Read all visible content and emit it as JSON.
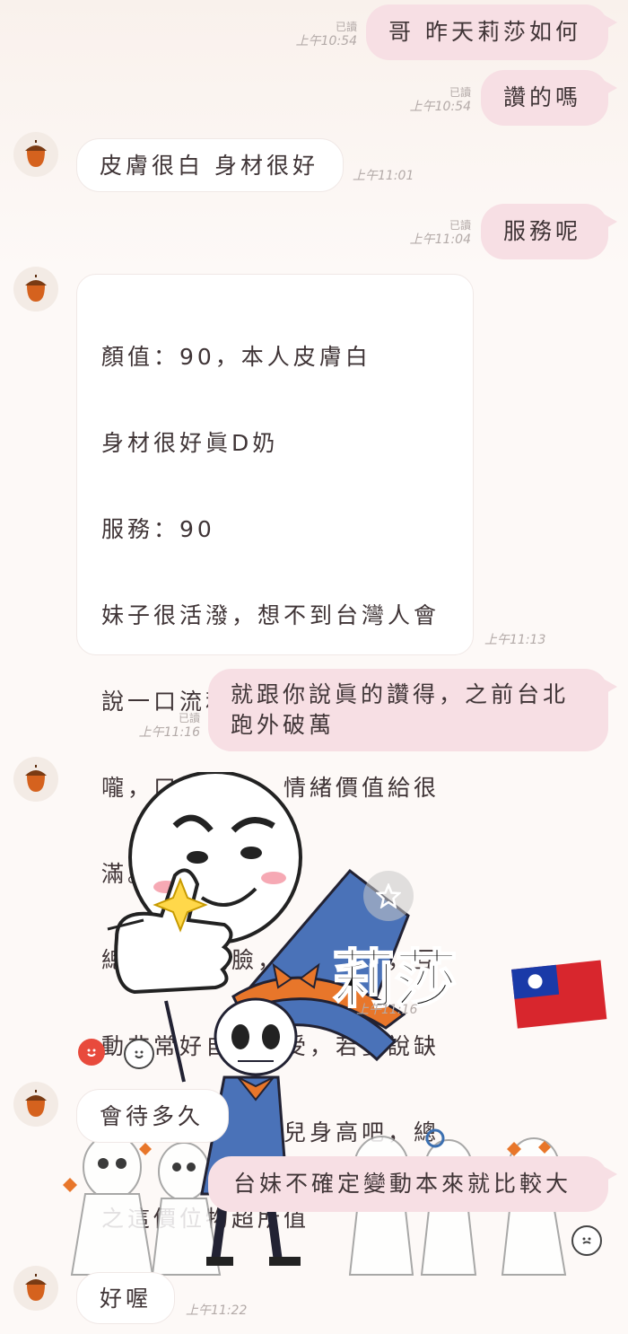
{
  "messages": {
    "m1": {
      "text": "哥 昨天莉莎如何",
      "read": "已讀",
      "time": "上午10:54"
    },
    "m2": {
      "text": "讚的嗎",
      "read": "已讀",
      "time": "上午10:54"
    },
    "m3": {
      "text": "皮膚很白 身材很好",
      "time": "上午11:01"
    },
    "m4": {
      "text": "服務呢",
      "read": "已讀",
      "time": "上午11:04"
    },
    "m5": {
      "lines": [
        "顏值：90，本人皮膚白",
        "身材很好眞D奶",
        "服務：90",
        "妹子很活潑，想不到台灣人會",
        "說一口流利英語，很會深喉",
        "嚨，口技一流，情緒價值給很",
        "滿。",
        "總結全程笑臉，服務滿滿，互",
        "動非常好自己感受，若要說缺",
        "點就是太高模特兒身高吧，總",
        "之這價位物超所值"
      ],
      "time": "上午11:13"
    },
    "m6": {
      "text": "就跟你說眞的讚得，之前台北\n跑外破萬",
      "read": "已讀",
      "time": "上午11:16"
    },
    "m7": {
      "sticker_caption": "莉莎",
      "time": "上午11:16"
    },
    "m8": {
      "text": "會待多久"
    },
    "m9": {
      "text": "台妹不確定變動本來就比較大"
    },
    "m10": {
      "text": "好喔",
      "time": "上午11:22"
    }
  },
  "icons": {
    "avatar": "acorn-icon",
    "reaction": "smile-reaction-icon",
    "emoji": "emoji-picker-icon",
    "star": "star-icon",
    "flag": "taiwan-flag-icon"
  },
  "colors": {
    "my_bubble": "#f7dfe4",
    "their_bubble": "#ffffff",
    "background": "#fdf9f7",
    "reaction_red": "#e84a3c"
  }
}
